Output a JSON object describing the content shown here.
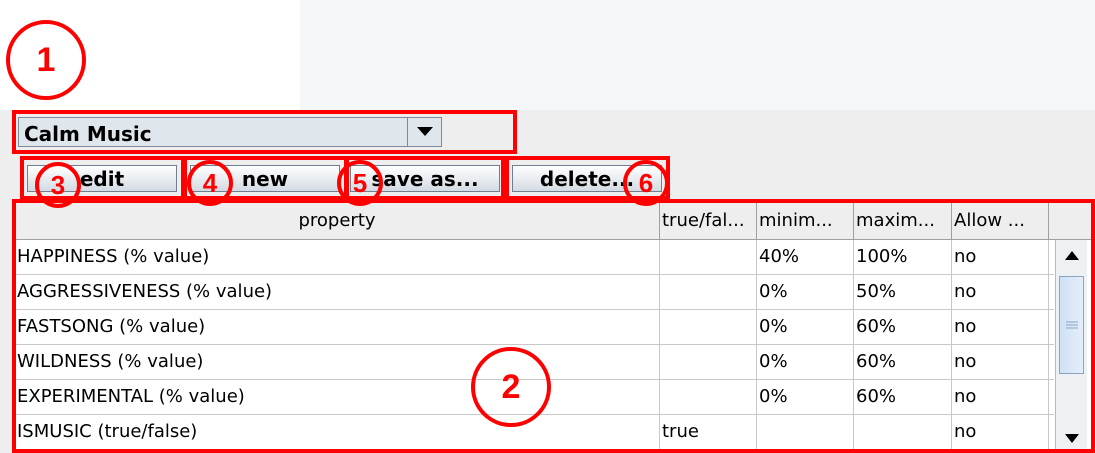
{
  "combo": {
    "selected": "Calm Music"
  },
  "buttons": {
    "edit": "edit",
    "new": "new",
    "save_as": "save as...",
    "delete": "delete..."
  },
  "table": {
    "headers": [
      "property",
      "true/fal...",
      "minim...",
      "maxim...",
      "Allow ..."
    ],
    "rows": [
      [
        "HAPPINESS (% value)",
        "",
        "40%",
        "100%",
        "no"
      ],
      [
        "AGGRESSIVENESS (% value)",
        "",
        "0%",
        "50%",
        "no"
      ],
      [
        "FASTSONG (% value)",
        "",
        "0%",
        "60%",
        "no"
      ],
      [
        "WILDNESS (% value)",
        "",
        "0%",
        "60%",
        "no"
      ],
      [
        "EXPERIMENTAL (% value)",
        "",
        "0%",
        "60%",
        "no"
      ],
      [
        "ISMUSIC (true/false)",
        "true",
        "",
        "",
        "no"
      ]
    ]
  },
  "annotations": [
    "1",
    "2",
    "3",
    "4",
    "5",
    "6"
  ],
  "colors": {
    "annotation": "#ff0000",
    "panel": "#eeeeee"
  }
}
